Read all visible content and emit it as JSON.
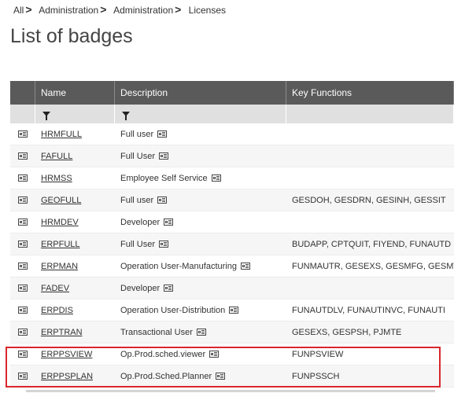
{
  "breadcrumb": [
    "All",
    "Administration",
    "Administration",
    "Licenses"
  ],
  "page_title": "List of badges",
  "columns": {
    "name": "Name",
    "description": "Description",
    "key_functions": "Key Functions"
  },
  "rows": [
    {
      "name": "HRMFULL",
      "description": "Full user",
      "key_functions": ""
    },
    {
      "name": "FAFULL",
      "description": "Full User",
      "key_functions": ""
    },
    {
      "name": "HRMSS",
      "description": "Employee Self Service",
      "key_functions": ""
    },
    {
      "name": "GEOFULL",
      "description": "Full user",
      "key_functions": "GESDOH, GESDRN, GESINH, GESSIT"
    },
    {
      "name": "HRMDEV",
      "description": "Developer",
      "key_functions": ""
    },
    {
      "name": "ERPFULL",
      "description": "Full User",
      "key_functions": "BUDAPP, CPTQUIT, FIYEND, FUNAUTD"
    },
    {
      "name": "ERPMAN",
      "description": "Operation User-Manufacturing",
      "key_functions": "FUNMAUTR, GESEXS, GESMFG, GESMT"
    },
    {
      "name": "FADEV",
      "description": "Developer",
      "key_functions": ""
    },
    {
      "name": "ERPDIS",
      "description": "Operation User-Distribution",
      "key_functions": "FUNAUTDLV, FUNAUTINVC, FUNAUTI"
    },
    {
      "name": "ERPTRAN",
      "description": "Transactional User",
      "key_functions": "GESEXS, GESPSH, PJMTE"
    },
    {
      "name": "ERPPSVIEW",
      "description": "Op.Prod.sched.viewer",
      "key_functions": "FUNPSVIEW"
    },
    {
      "name": "ERPPSPLAN",
      "description": "Op.Prod.Sched.Planner",
      "key_functions": "FUNPSSCH"
    }
  ],
  "highlight_color": "#d9262c",
  "icons": {
    "row_detail": "card-icon",
    "filter": "funnel-icon"
  }
}
